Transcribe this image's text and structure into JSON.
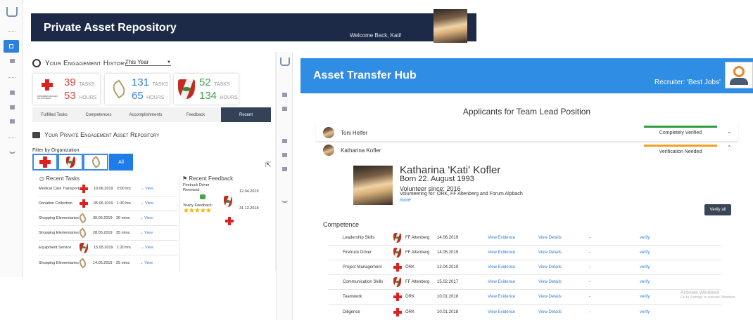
{
  "app1": {
    "header_title": "Private Asset Repository",
    "welcome": "Welcome Back, Kati!",
    "engagement": {
      "title": "Your Engagement History",
      "period": "This Year",
      "cards": [
        {
          "org": "ÖRK",
          "org_sub": "ÖSTERREICHISCHES ROTES KREUZ",
          "tasks": "39",
          "tasks_label": "TASKS",
          "hours": "53",
          "hours_label": "HOURS",
          "color": "#d44a3a"
        },
        {
          "org": "Forum Alpbach",
          "tasks": "131",
          "tasks_label": "TASKS",
          "hours": "65",
          "hours_label": "HOURS",
          "color": "#3b7fd6"
        },
        {
          "org": "FF Altenberg",
          "tasks": "52",
          "tasks_label": "TASKS",
          "hours": "134",
          "hours_label": "HOURS",
          "color": "#47a14b"
        }
      ],
      "tabs": [
        "Fulfilled Tasks",
        "Competences",
        "Accomplishments",
        "Feedback",
        "Recent"
      ],
      "active_tab": "Recent"
    },
    "repository": {
      "title": "Your Private Engagement Asset Repository",
      "filter_label": "Filter by Organization",
      "all_button": "All",
      "recent_tasks_title": "Recent Tasks",
      "tasks": [
        {
          "name": "Medical Care Transport",
          "org_icon": "red-cross",
          "date": "10.06.2019",
          "duration": "2:00 hrs",
          "action": "View"
        },
        {
          "name": "Donation Collection",
          "org_icon": "red-cross",
          "date": "05.06.2019",
          "duration": "1:30 hrs",
          "action": "View"
        },
        {
          "name": "Shopping Elementaries",
          "org_icon": "leaf",
          "date": "30.05.2019",
          "duration": "30 mins",
          "action": "View"
        },
        {
          "name": "Shopping Elementaries",
          "org_icon": "leaf",
          "date": "28.05.2019",
          "duration": "35 mins",
          "action": "View"
        },
        {
          "name": "Equipment Service",
          "org_icon": "shield",
          "date": "15.05.2019",
          "duration": "1:20 hrs",
          "action": "View"
        },
        {
          "name": "Shopping Elementaries",
          "org_icon": "leaf",
          "date": "14.05.2019",
          "duration": "25 mins",
          "action": "View"
        }
      ],
      "recent_feedback_title": "Recent Feedback",
      "feedback": [
        {
          "text": "Firetruck Driver Renewed:",
          "org_icon": "shield",
          "date": "12.04.2019"
        },
        {
          "text": "Yearly Feedback:",
          "stars": 5,
          "org_icon": "red-cross",
          "date": "31.12.2018"
        }
      ]
    }
  },
  "app2": {
    "header_title": "Asset Transfer Hub",
    "recruiter": "Recruiter: 'Best Jobs'",
    "section_title": "Applicants for Team Lead Position",
    "applicants": [
      {
        "name": "Toni Helfer",
        "status": "Completely Verified",
        "status_color": "#2e9e3f",
        "expanded": false
      },
      {
        "name": "Katharina Kofler",
        "status": "Verification Needed",
        "status_color": "#f0a020",
        "expanded": true
      }
    ],
    "detail": {
      "full_name": "Katharina 'Kati' Kofler",
      "born": "Born 22. August 1993",
      "volunteer_since": "Volunteer since: 2016",
      "volunteering_for": "Volunteering for: ÖRK, FF Altenberg and Forum Alpbach",
      "more": "more",
      "verify_all": "Verify all"
    },
    "competence_title": "Competence",
    "competences": [
      {
        "skill": "Leadership Skills",
        "org_icon": "shield",
        "org": "FF Altenberg",
        "date": "14.06.2019",
        "evidence": "View Evidence",
        "details": "View Details",
        "dash": "-",
        "verify": "verify"
      },
      {
        "skill": "Firetruck Driver",
        "org_icon": "shield",
        "org": "FF Altenberg",
        "date": "14.05.2019",
        "evidence": "View Evidence",
        "details": "View Details",
        "dash": "-",
        "verify": "verify"
      },
      {
        "skill": "Project Management",
        "org_icon": "red-cross",
        "org": "ÖRK",
        "date": "12.04.2019",
        "evidence": "View Evidence",
        "details": "View Details",
        "dash": "-",
        "verify": "verify"
      },
      {
        "skill": "Communication Skills",
        "org_icon": "shield",
        "org": "FF Altenberg",
        "date": "15.02.2017",
        "evidence": "View Evidence",
        "details": "View Details",
        "dash": "-",
        "verify": "verify"
      },
      {
        "skill": "Teamwork",
        "org_icon": "red-cross",
        "org": "ÖRK",
        "date": "10.01.2018",
        "evidence": "View Evidence",
        "details": "View Details",
        "dash": "-",
        "verify": "verify"
      },
      {
        "skill": "Diligence",
        "org_icon": "red-cross",
        "org": "ÖRK",
        "date": "10.01.2018",
        "evidence": "View Evidence",
        "details": "View Details",
        "dash": "-",
        "verify": "verify"
      }
    ],
    "watermark_title": "Activate Windows",
    "watermark_sub": "Go to Settings to activate Windows."
  },
  "colors": {
    "header_dark": "#1c2a47",
    "header_blue": "#2f8de4",
    "recent_tab": "#344257",
    "verify_btn": "#3a4556"
  }
}
